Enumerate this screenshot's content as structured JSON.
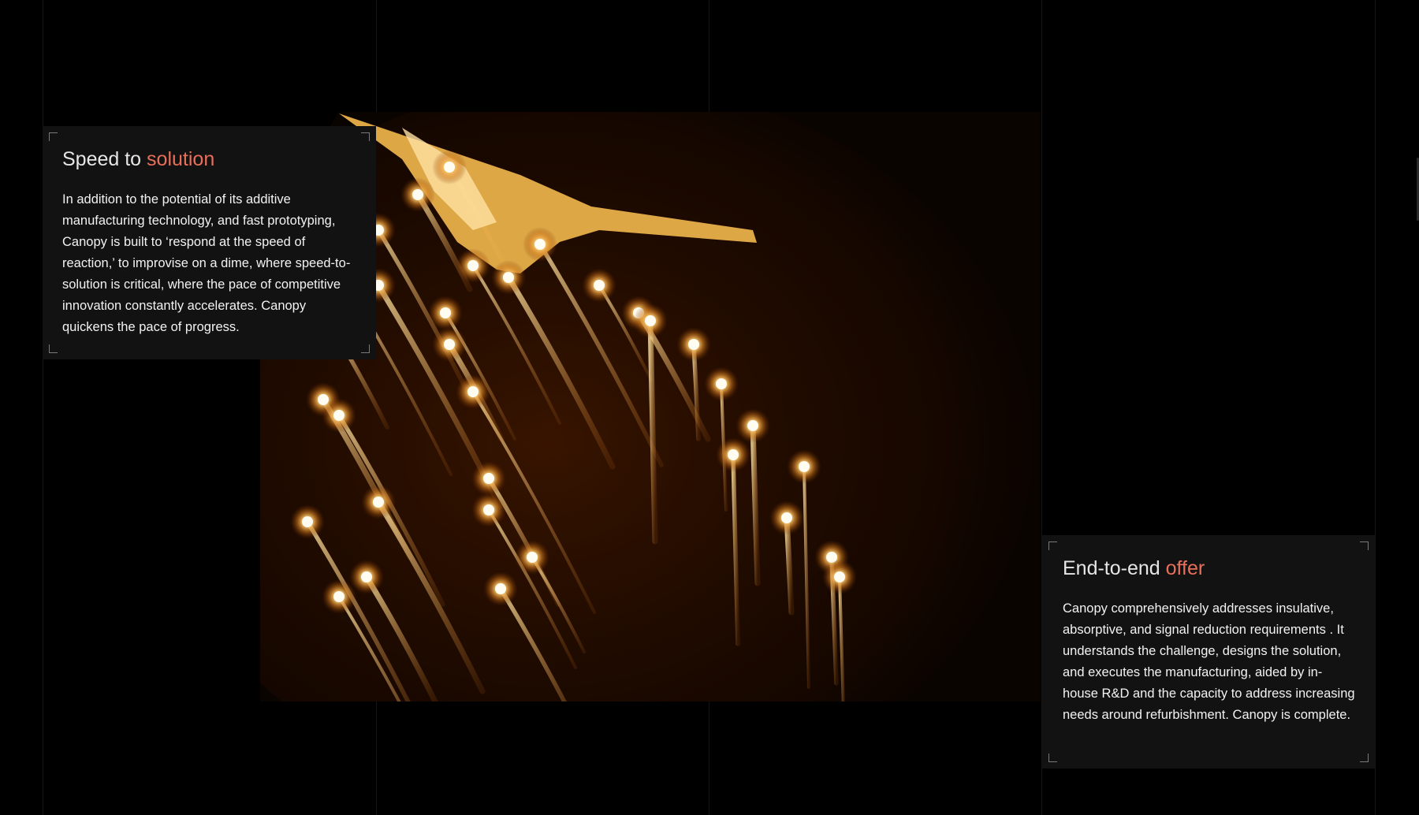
{
  "colors": {
    "background": "#000000",
    "card": "#121212",
    "accent": "#e8705a",
    "title": "#e6e6e6",
    "body": "#f2f2f2"
  },
  "hero": {
    "subject": "aircraft releasing flares at night"
  },
  "cards": [
    {
      "title_plain": "Speed to",
      "title_accent": "solution",
      "body": "In addition to the potential of its additive manufacturing technology, and fast prototyping, Canopy is built to ‘respond at the speed of reaction,’ to improvise on a dime, where speed-to-solution is critical, where the pace of competitive innovation constantly accelerates. Canopy quickens the pace of progress."
    },
    {
      "title_plain": "End-to-end",
      "title_accent": "offer",
      "body": "Canopy comprehensively addresses insulative, absorptive, and signal reduction requirements . It understands the challenge, designs the solution, and executes the manufacturing, aided by in-house R&D and the capacity to address increasing needs around refurbishment. Canopy is complete."
    }
  ]
}
